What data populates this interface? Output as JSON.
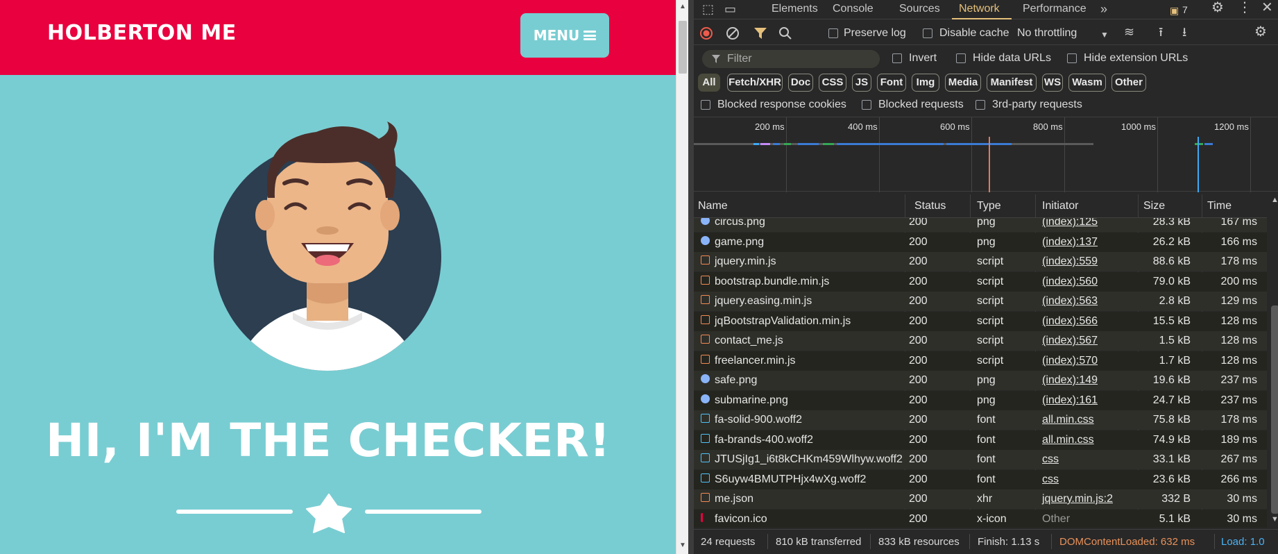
{
  "page": {
    "brand": "HOLBERTON ME",
    "menu_label": "MENU",
    "hero_title": "HI, I'M THE CHECKER!",
    "colors": {
      "navbar": "#e8003f",
      "background": "#78cdd2",
      "avatar_circle": "#2c3e50"
    }
  },
  "devtools": {
    "tabs": [
      "Elements",
      "Console",
      "Sources",
      "Network",
      "Performance"
    ],
    "active_tab": "Network",
    "issues_count": "7",
    "toolbar": {
      "preserve_log": "Preserve log",
      "disable_cache": "Disable cache",
      "throttling": "No throttling"
    },
    "filter": {
      "placeholder": "Filter",
      "invert": "Invert",
      "hide_data_urls": "Hide data URLs",
      "hide_extension_urls": "Hide extension URLs"
    },
    "type_filters": [
      "All",
      "Fetch/XHR",
      "Doc",
      "CSS",
      "JS",
      "Font",
      "Img",
      "Media",
      "Manifest",
      "WS",
      "Wasm",
      "Other"
    ],
    "blocked": {
      "cookies": "Blocked response cookies",
      "requests": "Blocked requests",
      "third_party": "3rd-party requests"
    },
    "overview_ticks": [
      "200 ms",
      "400 ms",
      "600 ms",
      "800 ms",
      "1000 ms",
      "1200 ms"
    ],
    "columns": [
      "Name",
      "Status",
      "Type",
      "Initiator",
      "Size",
      "Time"
    ],
    "rows": [
      {
        "name": "circus.png",
        "status": "200",
        "type": "png",
        "initiator": "(index):125",
        "size": "28.3 kB",
        "time": "167 ms",
        "icon": "image-icon"
      },
      {
        "name": "game.png",
        "status": "200",
        "type": "png",
        "initiator": "(index):137",
        "size": "26.2 kB",
        "time": "166 ms",
        "icon": "image-icon"
      },
      {
        "name": "jquery.min.js",
        "status": "200",
        "type": "script",
        "initiator": "(index):559",
        "size": "88.6 kB",
        "time": "178 ms",
        "icon": "script-icon"
      },
      {
        "name": "bootstrap.bundle.min.js",
        "status": "200",
        "type": "script",
        "initiator": "(index):560",
        "size": "79.0 kB",
        "time": "200 ms",
        "icon": "script-icon"
      },
      {
        "name": "jquery.easing.min.js",
        "status": "200",
        "type": "script",
        "initiator": "(index):563",
        "size": "2.8 kB",
        "time": "129 ms",
        "icon": "script-icon"
      },
      {
        "name": "jqBootstrapValidation.min.js",
        "status": "200",
        "type": "script",
        "initiator": "(index):566",
        "size": "15.5 kB",
        "time": "128 ms",
        "icon": "script-icon"
      },
      {
        "name": "contact_me.js",
        "status": "200",
        "type": "script",
        "initiator": "(index):567",
        "size": "1.5 kB",
        "time": "128 ms",
        "icon": "script-icon"
      },
      {
        "name": "freelancer.min.js",
        "status": "200",
        "type": "script",
        "initiator": "(index):570",
        "size": "1.7 kB",
        "time": "128 ms",
        "icon": "script-icon"
      },
      {
        "name": "safe.png",
        "status": "200",
        "type": "png",
        "initiator": "(index):149",
        "size": "19.6 kB",
        "time": "237 ms",
        "icon": "image-icon"
      },
      {
        "name": "submarine.png",
        "status": "200",
        "type": "png",
        "initiator": "(index):161",
        "size": "24.7 kB",
        "time": "237 ms",
        "icon": "image-icon"
      },
      {
        "name": "fa-solid-900.woff2",
        "status": "200",
        "type": "font",
        "initiator": "all.min.css",
        "size": "75.8 kB",
        "time": "178 ms",
        "icon": "font-icon"
      },
      {
        "name": "fa-brands-400.woff2",
        "status": "200",
        "type": "font",
        "initiator": "all.min.css",
        "size": "74.9 kB",
        "time": "189 ms",
        "icon": "font-icon"
      },
      {
        "name": "JTUSjIg1_i6t8kCHKm459Wlhyw.woff2",
        "status": "200",
        "type": "font",
        "initiator": "css",
        "size": "33.1 kB",
        "time": "267 ms",
        "icon": "font-icon"
      },
      {
        "name": "S6uyw4BMUTPHjx4wXg.woff2",
        "status": "200",
        "type": "font",
        "initiator": "css",
        "size": "23.6 kB",
        "time": "266 ms",
        "icon": "font-icon"
      },
      {
        "name": "me.json",
        "status": "200",
        "type": "xhr",
        "initiator": "jquery.min.js:2",
        "size": "332 B",
        "time": "30 ms",
        "icon": "json-icon"
      },
      {
        "name": "favicon.ico",
        "status": "200",
        "type": "x-icon",
        "initiator": "Other",
        "size": "5.1 kB",
        "time": "30 ms",
        "icon": "favicon-icon"
      }
    ],
    "status": {
      "requests": "24 requests",
      "transferred": "810 kB transferred",
      "resources": "833 kB resources",
      "finish": "Finish: 1.13 s",
      "dom_content_loaded": "DOMContentLoaded: 632 ms",
      "load": "Load: 1.0"
    }
  }
}
